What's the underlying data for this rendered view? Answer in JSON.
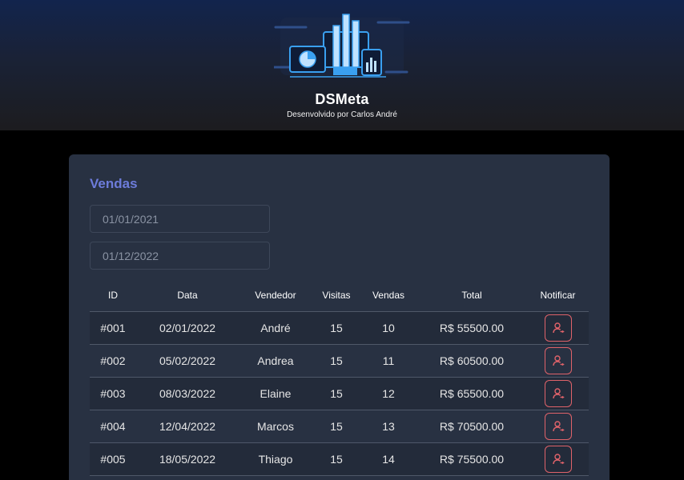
{
  "header": {
    "title": "DSMeta",
    "subtitle": "Desenvolvido por Carlos André",
    "logo_icon": "dashboard-devices-logo"
  },
  "sales": {
    "title": "Vendas",
    "min_date": "01/01/2021",
    "max_date": "01/12/2022",
    "columns": [
      "ID",
      "Data",
      "Vendedor",
      "Visitas",
      "Vendas",
      "Total",
      "Notificar"
    ],
    "rows": [
      {
        "id": "#001",
        "date": "02/01/2022",
        "seller": "André",
        "visits": "15",
        "deals": "10",
        "total": "R$ 55500.00"
      },
      {
        "id": "#002",
        "date": "05/02/2022",
        "seller": "Andrea",
        "visits": "15",
        "deals": "11",
        "total": "R$ 60500.00"
      },
      {
        "id": "#003",
        "date": "08/03/2022",
        "seller": "Elaine",
        "visits": "15",
        "deals": "12",
        "total": "R$ 65500.00"
      },
      {
        "id": "#004",
        "date": "12/04/2022",
        "seller": "Marcos",
        "visits": "15",
        "deals": "13",
        "total": "R$ 70500.00"
      },
      {
        "id": "#005",
        "date": "18/05/2022",
        "seller": "Thiago",
        "visits": "15",
        "deals": "14",
        "total": "R$ 75500.00"
      }
    ],
    "notify_icon": "notify-user-icon"
  },
  "colors": {
    "background": "#000000",
    "card": "#283142",
    "accent": "#6d7cdb",
    "notify": "#e0636a"
  }
}
